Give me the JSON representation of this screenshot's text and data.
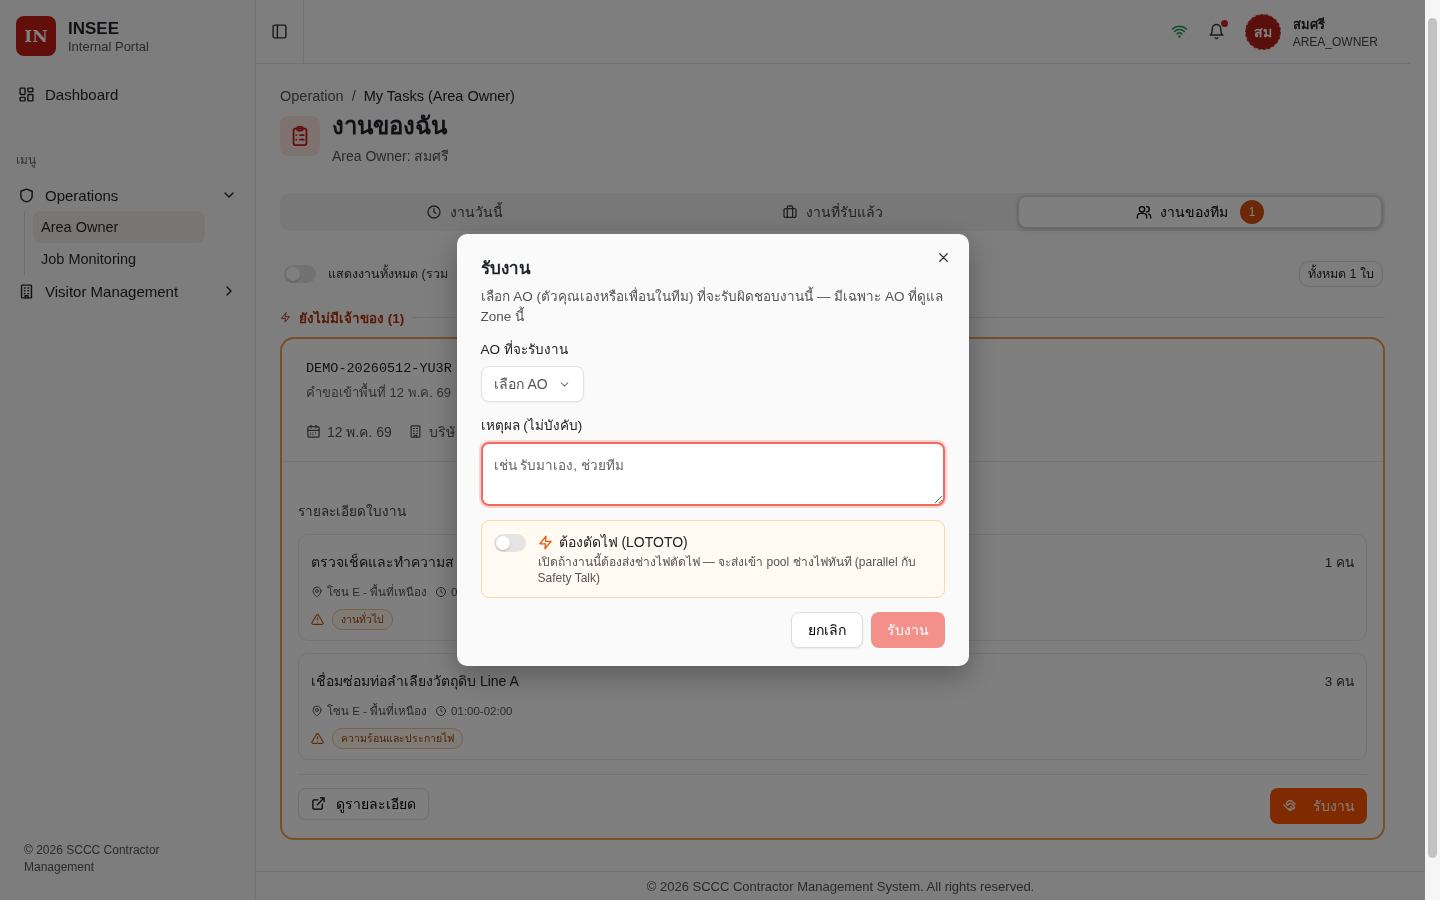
{
  "sidebar": {
    "brand": {
      "logo": "IN",
      "name": "INSEE",
      "subtitle": "Internal Portal"
    },
    "top_items": [
      {
        "label": "Dashboard"
      }
    ],
    "section_label": "เมนู",
    "menu": [
      {
        "label": "Operations",
        "expanded": true,
        "children": [
          {
            "label": "Area Owner",
            "selected": true
          },
          {
            "label": "Job Monitoring",
            "selected": false
          }
        ]
      },
      {
        "label": "Visitor Management",
        "expanded": false
      }
    ],
    "footer": "© 2026 SCCC Contractor Management"
  },
  "header": {
    "notifications_unread": true,
    "user": {
      "initials": "สม",
      "name": "สมศรี",
      "role": "AREA_OWNER"
    }
  },
  "breadcrumb": [
    "Operation",
    "My Tasks (Area Owner)"
  ],
  "breadcrumb_separator": "/",
  "page": {
    "title": "งานของฉัน",
    "subtitle": "Area Owner: สมศรี"
  },
  "tabs": [
    {
      "label": "งานวันนี้",
      "selected": false
    },
    {
      "label": "งานที่รับแล้ว",
      "selected": false
    },
    {
      "label": "งานของทีม",
      "selected": true,
      "badge": "1"
    }
  ],
  "filter": {
    "toggle_label": "แสดงงานทั้งหมด (รวม",
    "on": false,
    "count": "ทั้งหมด 1 ใบ"
  },
  "section_heading": "ยังไม่มีเจ้าของ (1)",
  "card": {
    "id": "DEMO-20260512-YU3R",
    "subtitle": "คำขอเข้าพื้นที่ 12 พ.ค. 69",
    "date": "12 พ.ค. 69",
    "company": "บริษั",
    "details_label": "รายละเอียดใบงาน",
    "tasks": [
      {
        "title": "ตรวจเช็คและทำความส",
        "location": "โซน E - พื้นที่เหนือง",
        "time": "0",
        "tag": "งานทั่วไป",
        "people": "1 คน"
      },
      {
        "title": "เชื่อมซ่อมท่อลำเลียงวัตถุดิบ Line A",
        "location": "โซน E - พื้นที่เหนือง",
        "time": "01:00-02:00",
        "tag": "ความร้อนและประกายไฟ",
        "people": "3 คน"
      }
    ],
    "view_button": "ดูรายละเอียด",
    "claim_button": "รับงาน"
  },
  "footer": "© 2026 SCCC Contractor Management System. All rights reserved.",
  "modal": {
    "title": "รับงาน",
    "description": "เลือก AO (ตัวคุณเองหรือเพื่อนในทีม) ที่จะรับผิดชอบงานนี้ — มีเฉพาะ AO ที่ดูแล Zone นี้",
    "ao_label": "AO ที่จะรับงาน",
    "ao_placeholder": "เลือก AO",
    "reason_label": "เหตุผล (ไม่บังคับ)",
    "reason_placeholder": "เช่น รับมาเอง, ช่วยทีม",
    "lototo": {
      "on": false,
      "title": "ต้องตัดไฟ (LOTOTO)",
      "description": "เปิดถ้างานนี้ต้องส่งช่างไฟตัดไฟ — จะส่งเข้า pool ช่างไฟทันที (parallel กับ Safety Talk)"
    },
    "cancel": "ยกเลิก",
    "confirm": "รับงาน",
    "confirm_disabled": true
  }
}
